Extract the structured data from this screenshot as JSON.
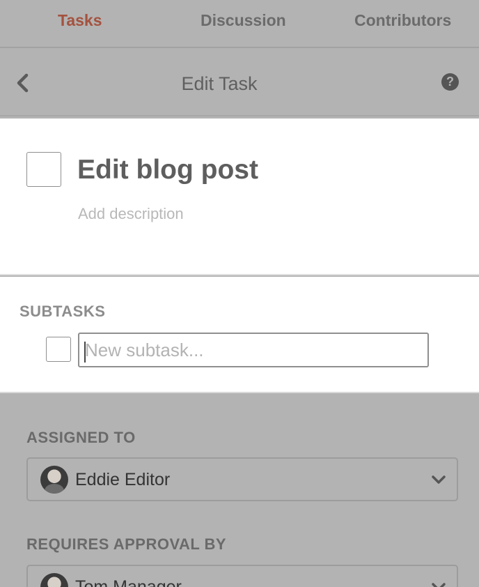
{
  "tabs": [
    {
      "label": "Tasks",
      "active": true
    },
    {
      "label": "Discussion",
      "active": false
    },
    {
      "label": "Contributors",
      "active": false
    }
  ],
  "header": {
    "title": "Edit Task",
    "back_icon": "chevron-left-icon",
    "help_icon": "question-circle-icon",
    "help_glyph": "?"
  },
  "task": {
    "title": "Edit blog post",
    "description_placeholder": "Add description"
  },
  "subtasks": {
    "label": "SUBTASKS",
    "input_placeholder": "New subtask...",
    "input_value": ""
  },
  "assigned_to": {
    "label": "ASSIGNED TO",
    "value": "Eddie Editor"
  },
  "requires_approval_by": {
    "label": "REQUIRES APPROVAL BY",
    "value": "Tom Manager"
  },
  "colors": {
    "active_tab": "#a4523f",
    "background": "#b3b3b3",
    "card": "#ffffff"
  }
}
